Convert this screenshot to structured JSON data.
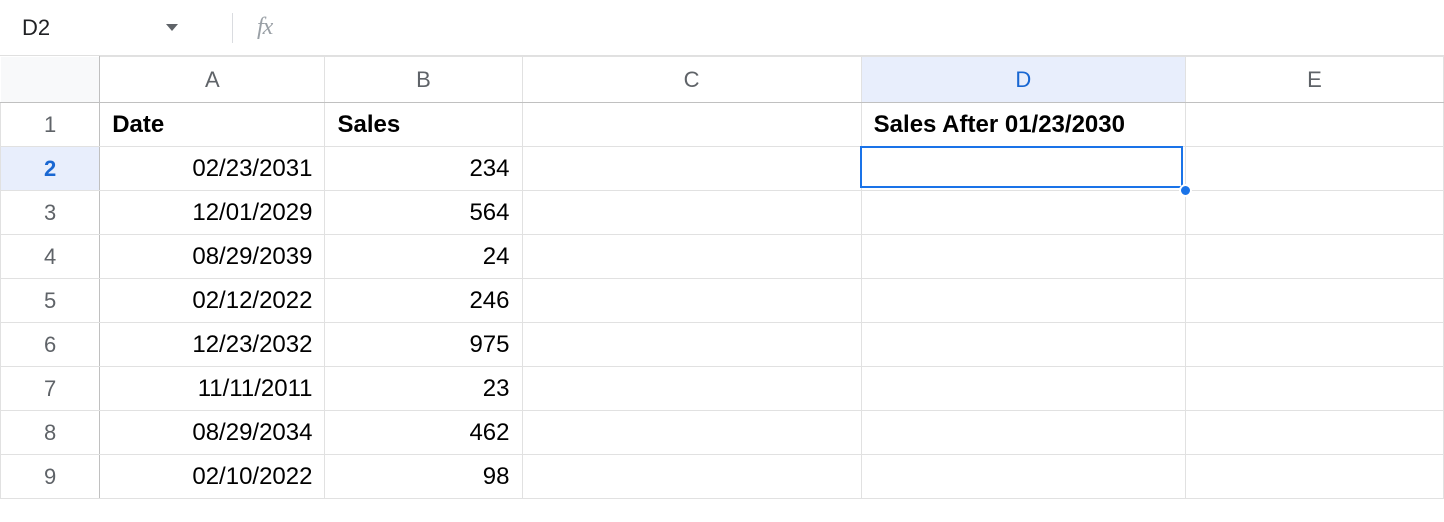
{
  "formula_bar": {
    "name_box": "D2",
    "fx_label": "fx",
    "formula": ""
  },
  "columns": [
    "A",
    "B",
    "C",
    "D",
    "E"
  ],
  "selected_column": "D",
  "row_numbers": [
    "1",
    "2",
    "3",
    "4",
    "5",
    "6",
    "7",
    "8",
    "9"
  ],
  "selected_row": "2",
  "headers": {
    "A": "Date",
    "B": "Sales",
    "D": "Sales After 01/23/2030"
  },
  "rows": [
    {
      "date": "02/23/2031",
      "sales": "234"
    },
    {
      "date": "12/01/2029",
      "sales": "564"
    },
    {
      "date": "08/29/2039",
      "sales": "24"
    },
    {
      "date": "02/12/2022",
      "sales": "246"
    },
    {
      "date": "12/23/2032",
      "sales": "975"
    },
    {
      "date": "11/11/2011",
      "sales": "23"
    },
    {
      "date": "08/29/2034",
      "sales": "462"
    },
    {
      "date": "02/10/2022",
      "sales": "98"
    }
  ]
}
